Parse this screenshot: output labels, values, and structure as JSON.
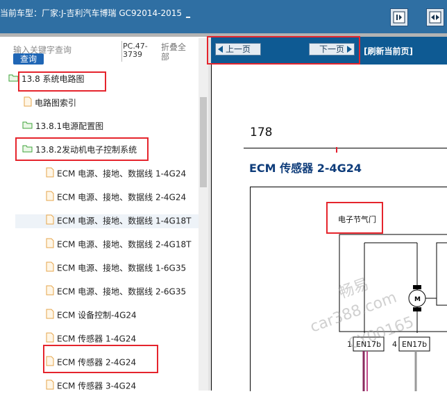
{
  "header": {
    "label": "当前车型：",
    "model": "厂家:J-吉利汽车博瑞 GC92014-2015",
    "link": "_"
  },
  "left": {
    "search_placeholder": "输入关键字查询",
    "search_button": "查询",
    "pc_info": "PC.47-3739",
    "collapse_all": "折叠全部",
    "tree": [
      {
        "label": "13.8 系统电路图",
        "icon": "folder-open-icon"
      },
      {
        "label": "电路图索引",
        "icon": "document-icon"
      },
      {
        "label": "13.8.1电源配置图",
        "icon": "folder-icon"
      },
      {
        "label": "13.8.2发动机电子控制系统",
        "icon": "folder-open-icon"
      },
      {
        "label": "ECM 电源、接地、数据线 1-4G24",
        "icon": "document-icon"
      },
      {
        "label": "ECM 电源、接地、数据线 2-4G24",
        "icon": "document-icon"
      },
      {
        "label": "ECM 电源、接地、数据线 1-4G18T",
        "icon": "document-icon"
      },
      {
        "label": "ECM 电源、接地、数据线 2-4G18T",
        "icon": "document-icon"
      },
      {
        "label": "ECM 电源、接地、数据线 1-6G35",
        "icon": "document-icon"
      },
      {
        "label": "ECM 电源、接地、数据线 2-6G35",
        "icon": "document-icon"
      },
      {
        "label": "ECM 设备控制-4G24",
        "icon": "document-icon"
      },
      {
        "label": "ECM 传感器 1-4G24",
        "icon": "document-icon"
      },
      {
        "label": "ECM 传感器 2-4G24",
        "icon": "document-icon"
      },
      {
        "label": "ECM 传感器 3-4G24",
        "icon": "document-icon"
      }
    ]
  },
  "nav": {
    "prev": "上一页",
    "next": "下一页",
    "refresh": "[刷新当前页]"
  },
  "doc": {
    "page_number": "178",
    "title": "ECM 传感器 2-4G24",
    "component_label": "电子节气门",
    "motor_label": "M",
    "connector1_pin": "1",
    "connector1": "EN17b",
    "connector2_pin": "4",
    "connector2": "EN17b"
  },
  "watermark": {
    "line1": "畅易",
    "line2": "car388.com",
    "line3": "CY00165"
  },
  "colors": {
    "header_bg": "#2f6fa3",
    "nav_bg": "#0e5a93",
    "highlight_box": "#e5242c",
    "title_blue": "#0e3c7a"
  }
}
